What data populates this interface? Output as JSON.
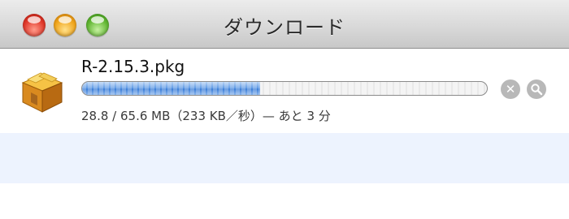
{
  "window": {
    "title": "ダウンロード"
  },
  "download": {
    "filename": "R-2.15.3.pkg",
    "progress_fraction": 0.44,
    "status": "28.8 / 65.6 MB（233 KB／秒）— あと 3 分",
    "icon": "package-icon"
  },
  "buttons": {
    "stop_icon": "stop-icon",
    "reveal_icon": "magnifier-icon"
  },
  "colors": {
    "progress_blue": "#3a7cd6",
    "alternate_row": "#edf3fe"
  }
}
